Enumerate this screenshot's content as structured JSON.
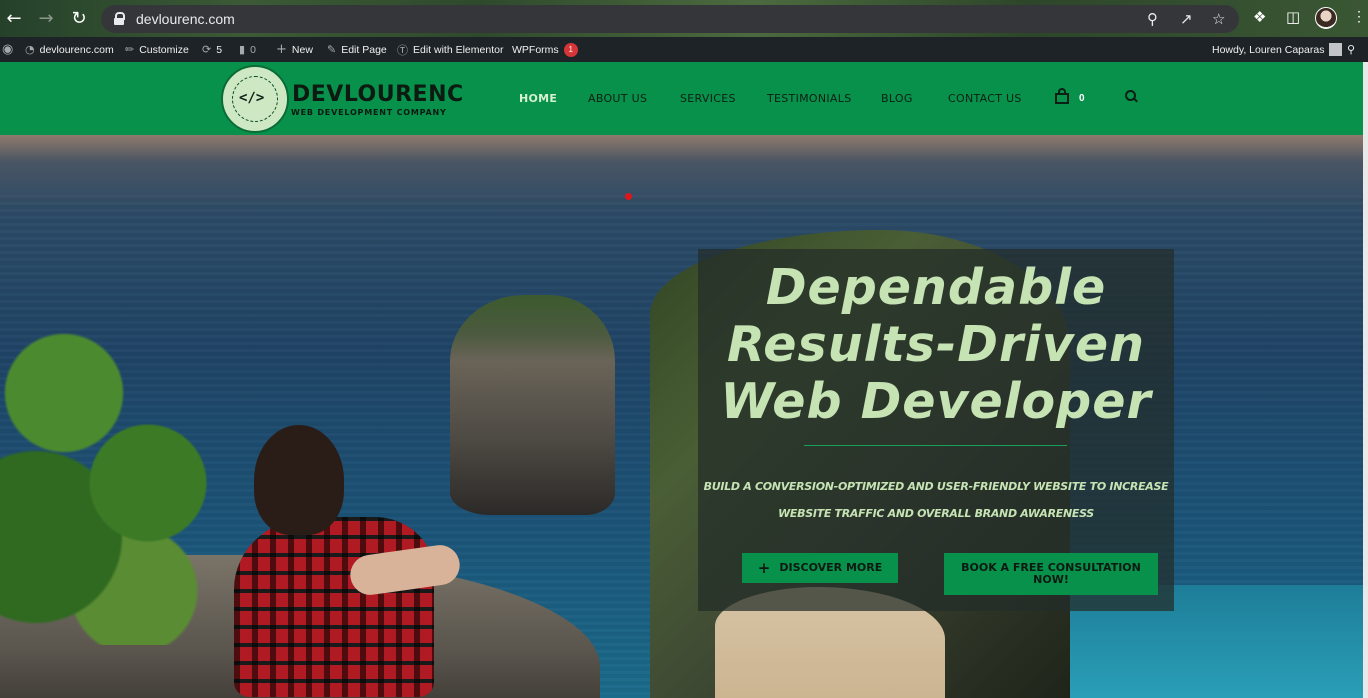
{
  "browser": {
    "url": "devlourenc.com",
    "icons": [
      "back-icon",
      "forward-icon",
      "reload-icon",
      "lock-icon",
      "zoom-icon",
      "share-icon",
      "bookmark-star-icon",
      "extensions-icon",
      "sidepanel-icon",
      "profile-avatar",
      "menu-icon"
    ]
  },
  "adminbar": {
    "site_name": "devlourenc.com",
    "customize": "Customize",
    "updates_count": "5",
    "comments_count": "0",
    "new": "New",
    "edit_page": "Edit Page",
    "edit_elementor": "Edit with Elementor",
    "wpforms": "WPForms",
    "wpforms_badge": "1",
    "howdy": "Howdy, Louren Caparas"
  },
  "header": {
    "logo_badge_text": "DEVLOURENC",
    "logo_mark": "<∕>",
    "logo_name": "DEVLOURENC",
    "logo_tagline": "WEB DEVELOPMENT COMPANY",
    "menu": [
      "HOME",
      "ABOUT US",
      "SERVICES",
      "TESTIMONIALS",
      "BLOG",
      "CONTACT US"
    ],
    "cart_count": "0",
    "colors": {
      "brand_green": "#07914a",
      "active_menu": "#d7f0cf"
    }
  },
  "hero": {
    "title_lines": [
      "Dependable",
      "Results-Driven",
      "Web Developer"
    ],
    "subtitle_lines": [
      "BUILD A CONVERSION-OPTIMIZED AND USER-FRIENDLY WEBSITE TO INCREASE",
      "WEBSITE TRAFFIC AND OVERALL BRAND AWARENESS"
    ],
    "btn_discover": "DISCOVER MORE",
    "btn_consult": "BOOK A FREE CONSULTATION NOW!",
    "colors": {
      "title": "#c6e3b4",
      "button_bg": "#07914a"
    }
  }
}
